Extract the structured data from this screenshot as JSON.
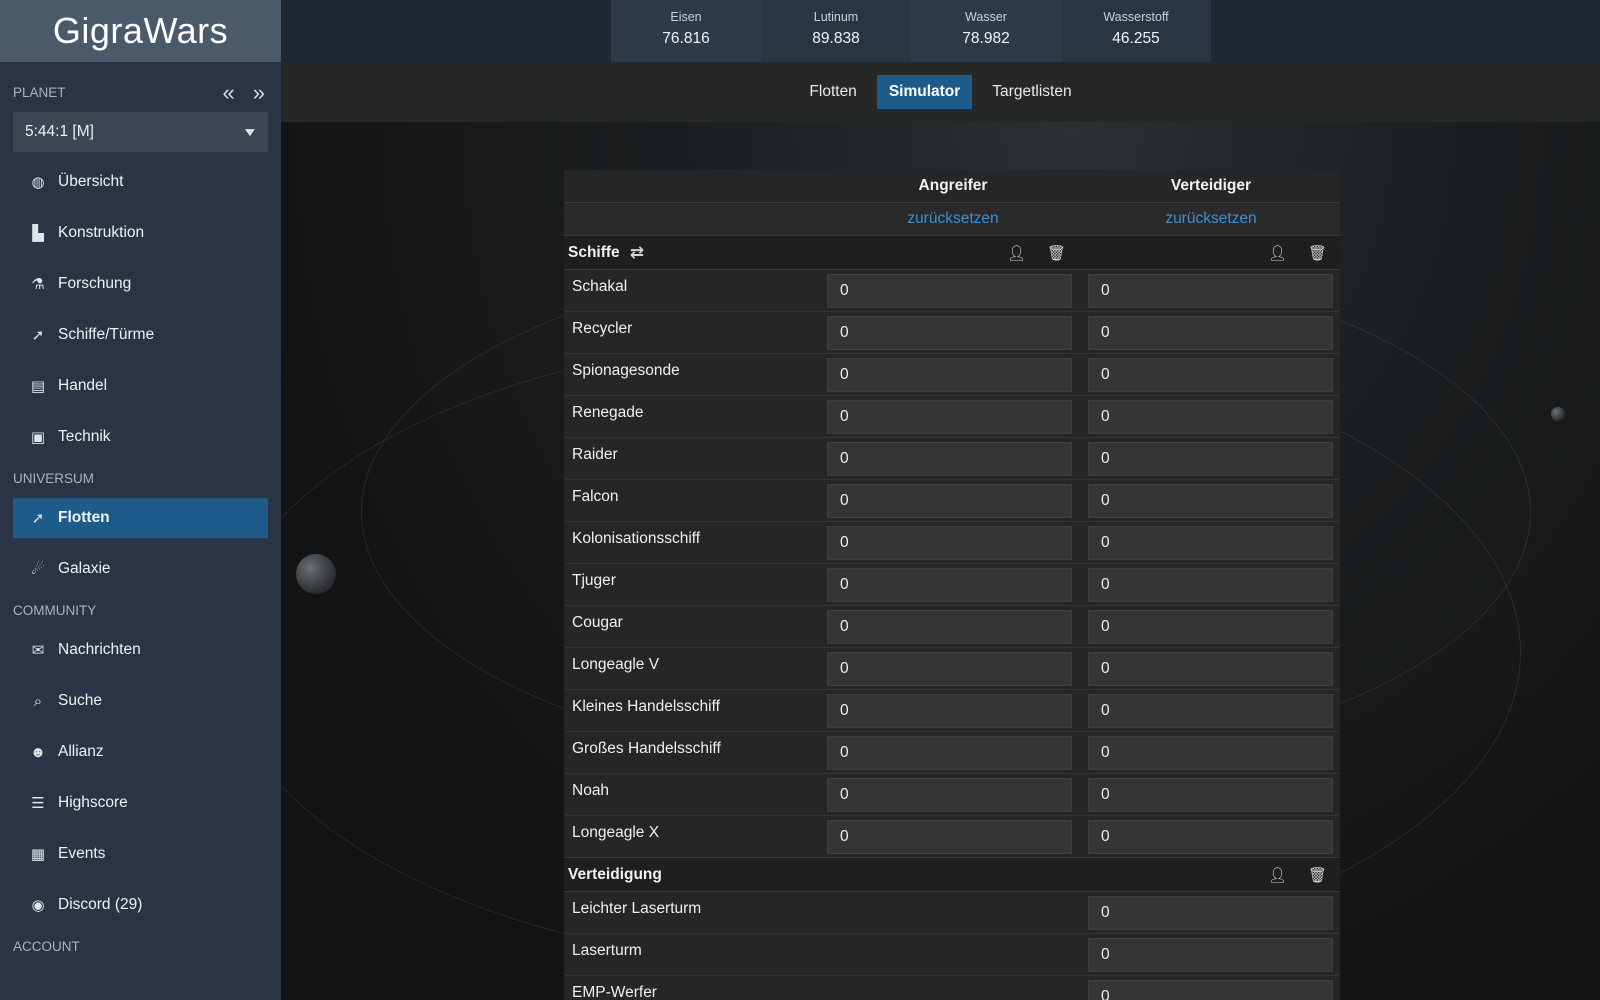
{
  "app": {
    "logo": "GigraWars"
  },
  "sidebar": {
    "planet_title": "PLANET",
    "planet_value": "5:44:1 [M]",
    "prev_icon": "«",
    "next_icon": "»",
    "sections": [
      {
        "title": "",
        "items": [
          {
            "label": "Übersicht",
            "icon": "globe-icon",
            "glyph": "◍"
          },
          {
            "label": "Konstruktion",
            "icon": "factory-icon",
            "glyph": "▙"
          },
          {
            "label": "Forschung",
            "icon": "flask-icon",
            "glyph": "⚗"
          },
          {
            "label": "Schiffe/Türme",
            "icon": "rocket-icon",
            "glyph": "➚"
          },
          {
            "label": "Handel",
            "icon": "chart-icon",
            "glyph": "▤"
          },
          {
            "label": "Technik",
            "icon": "chip-icon",
            "glyph": "▣"
          }
        ]
      },
      {
        "title": "UNIVERSUM",
        "items": [
          {
            "label": "Flotten",
            "icon": "rocket-icon",
            "glyph": "➚",
            "active": true
          },
          {
            "label": "Galaxie",
            "icon": "meteor-icon",
            "glyph": "☄"
          }
        ]
      },
      {
        "title": "COMMUNITY",
        "items": [
          {
            "label": "Nachrichten",
            "icon": "envelope-icon",
            "glyph": "✉"
          },
          {
            "label": "Suche",
            "icon": "search-icon",
            "glyph": "⌕"
          },
          {
            "label": "Allianz",
            "icon": "users-icon",
            "glyph": "☻"
          },
          {
            "label": "Highscore",
            "icon": "list-icon",
            "glyph": "☰"
          },
          {
            "label": "Events",
            "icon": "calendar-icon",
            "glyph": "▦"
          },
          {
            "label": "Discord (29)",
            "icon": "discord-icon",
            "glyph": "◉"
          }
        ]
      },
      {
        "title": "ACCOUNT",
        "items": []
      }
    ]
  },
  "resources": [
    {
      "name": "Eisen",
      "value": "76.816"
    },
    {
      "name": "Lutinum",
      "value": "89.838"
    },
    {
      "name": "Wasser",
      "value": "78.982"
    },
    {
      "name": "Wasserstoff",
      "value": "46.255"
    }
  ],
  "tabs": [
    {
      "label": "Flotten",
      "active": false
    },
    {
      "label": "Simulator",
      "active": true
    },
    {
      "label": "Targetlisten",
      "active": false
    }
  ],
  "simulator": {
    "attacker_header": "Angreifer",
    "defender_header": "Verteidiger",
    "reset_label": "zurücksetzen",
    "ships_title": "Schiffe",
    "ships": [
      {
        "name": "Schakal",
        "att": "0",
        "def": "0"
      },
      {
        "name": "Recycler",
        "att": "0",
        "def": "0"
      },
      {
        "name": "Spionagesonde",
        "att": "0",
        "def": "0"
      },
      {
        "name": "Renegade",
        "att": "0",
        "def": "0"
      },
      {
        "name": "Raider",
        "att": "0",
        "def": "0"
      },
      {
        "name": "Falcon",
        "att": "0",
        "def": "0"
      },
      {
        "name": "Kolonisationsschiff",
        "att": "0",
        "def": "0"
      },
      {
        "name": "Tjuger",
        "att": "0",
        "def": "0"
      },
      {
        "name": "Cougar",
        "att": "0",
        "def": "0"
      },
      {
        "name": "Longeagle V",
        "att": "0",
        "def": "0"
      },
      {
        "name": "Kleines Handelsschiff",
        "att": "0",
        "def": "0"
      },
      {
        "name": "Großes Handelsschiff",
        "att": "0",
        "def": "0"
      },
      {
        "name": "Noah",
        "att": "0",
        "def": "0"
      },
      {
        "name": "Longeagle X",
        "att": "0",
        "def": "0"
      }
    ],
    "defense_title": "Verteidigung",
    "defense": [
      {
        "name": "Leichter Laserturm",
        "def": "0"
      },
      {
        "name": "Laserturm",
        "def": "0"
      },
      {
        "name": "EMP-Werfer",
        "def": "0"
      }
    ]
  }
}
